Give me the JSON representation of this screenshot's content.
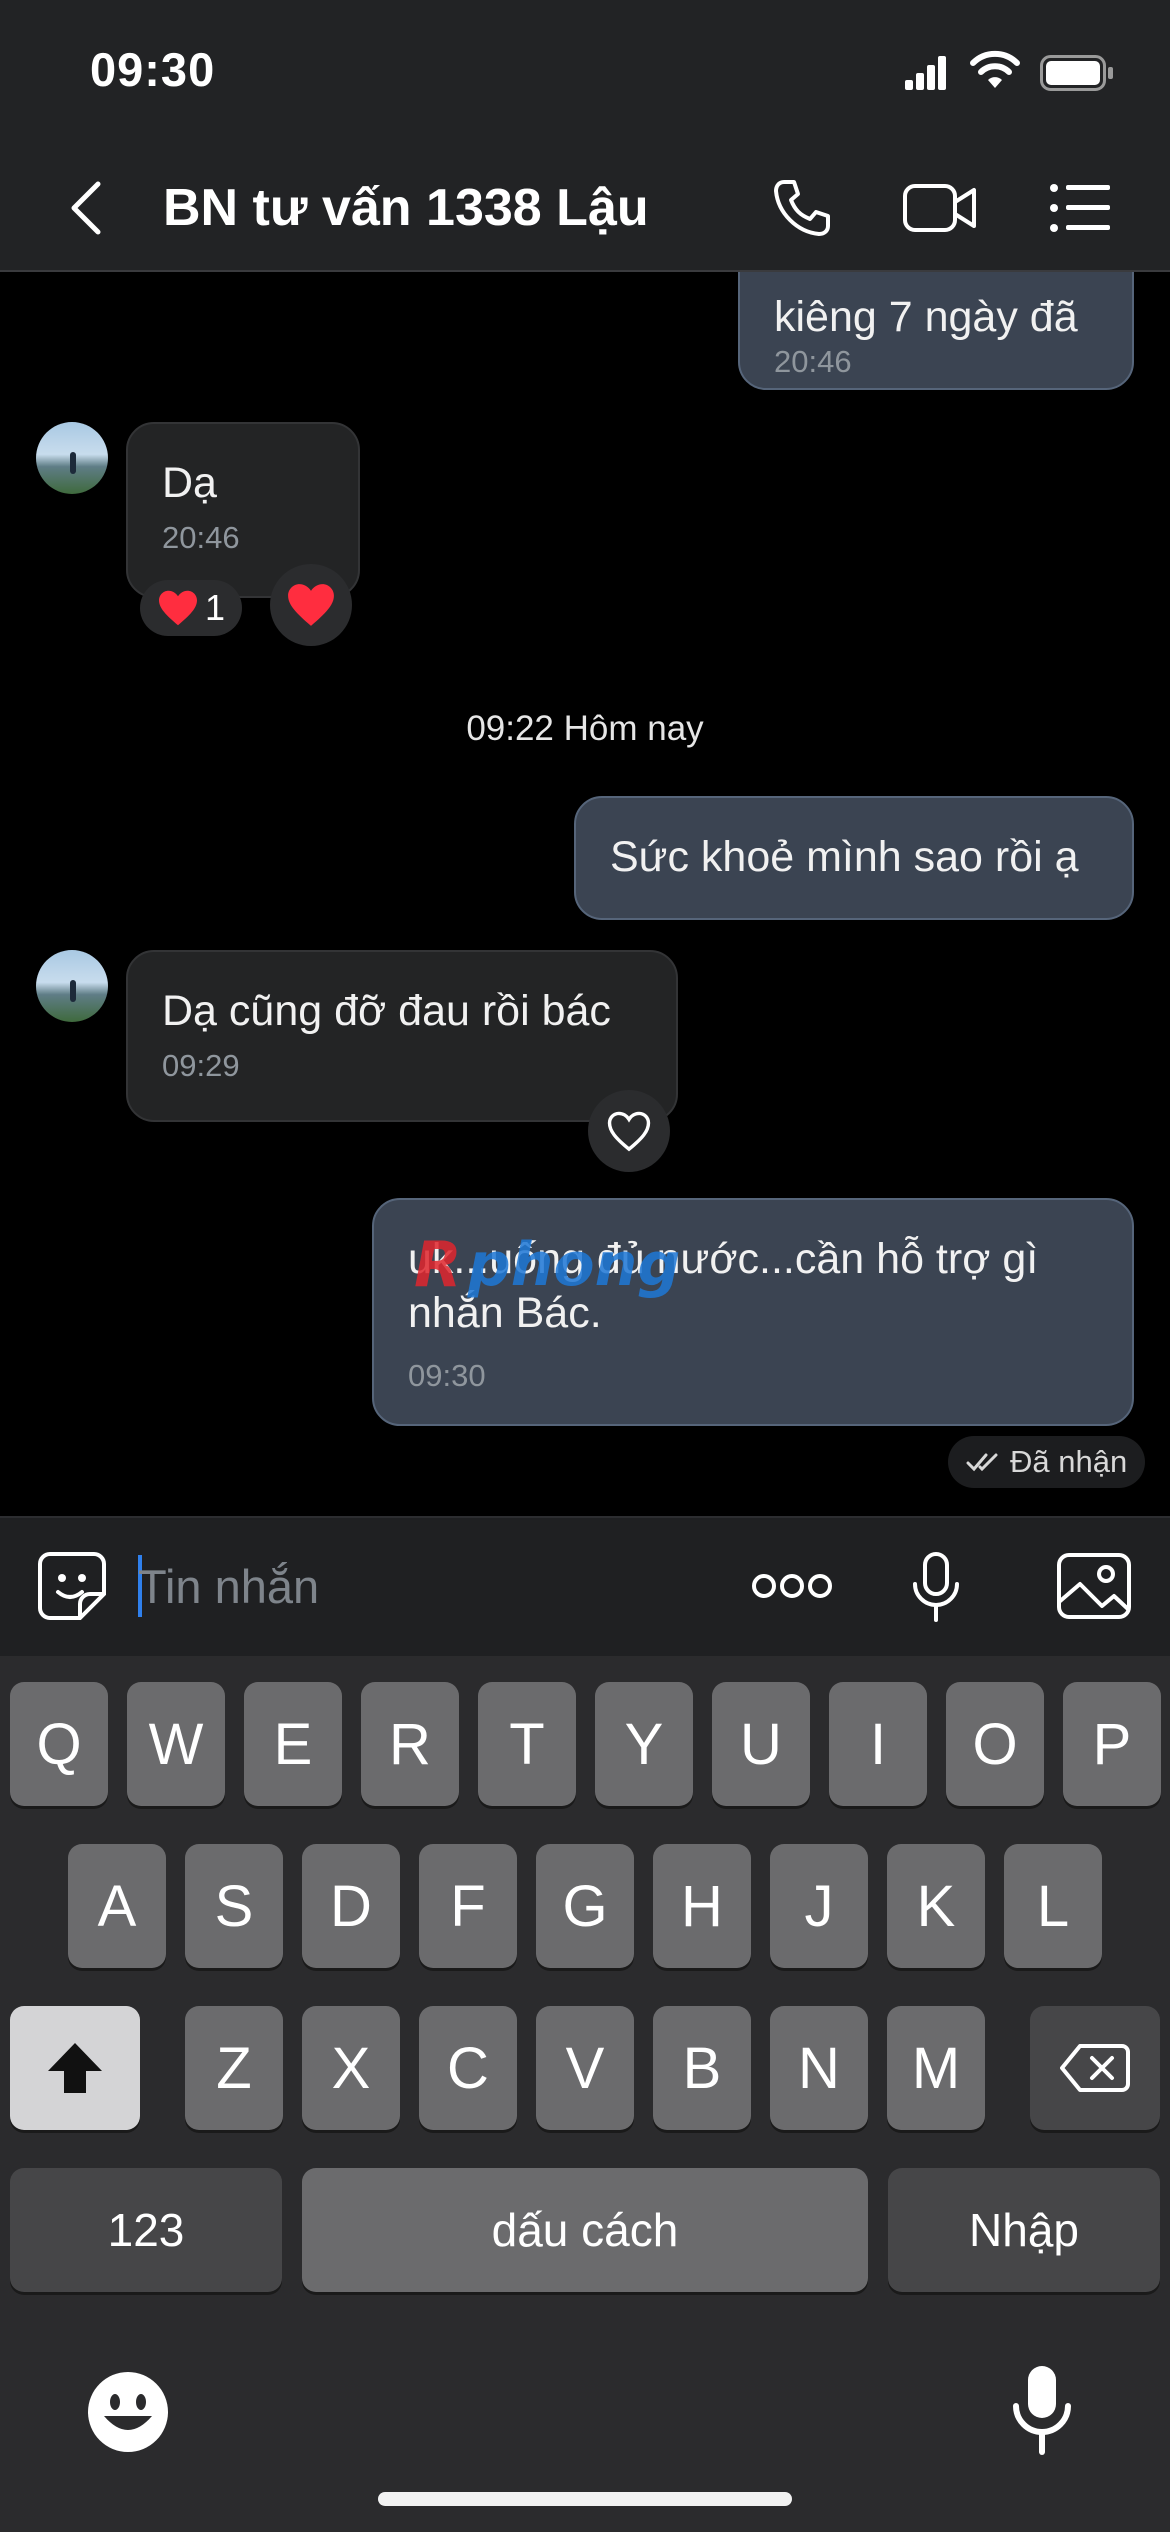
{
  "status_bar": {
    "time": "09:30"
  },
  "header": {
    "title": "BN tư vấn 1338 Lậu"
  },
  "messages": {
    "top_partial": {
      "text": "kiêng 7 ngày đã",
      "time": "20:46"
    },
    "msg1": {
      "text": "Dạ",
      "time": "20:46",
      "reaction_count": "1"
    },
    "separator": "09:22 Hôm nay",
    "msg2": {
      "text": "Sức khoẻ mình sao rồi ạ"
    },
    "msg3": {
      "text": "Dạ cũng đỡ đau rồi bác",
      "time": "09:29"
    },
    "msg4": {
      "line1": "uk...uống đủ nước...cần hỗ trợ gì",
      "line2": "nhắn Bác.",
      "time": "09:30",
      "status": "Đã nhận"
    }
  },
  "watermark": {
    "text": "phong"
  },
  "composer": {
    "placeholder": "Tin nhắn"
  },
  "keyboard": {
    "row1": [
      "Q",
      "W",
      "E",
      "R",
      "T",
      "Y",
      "U",
      "I",
      "O",
      "P"
    ],
    "row2": [
      "A",
      "S",
      "D",
      "F",
      "G",
      "H",
      "J",
      "K",
      "L"
    ],
    "row3": [
      "Z",
      "X",
      "C",
      "V",
      "B",
      "N",
      "M"
    ],
    "numbers": "123",
    "space": "dấu cách",
    "enter": "Nhập"
  },
  "colors": {
    "header_bg": "#222325",
    "outgoing_bubble": "#3b4452",
    "incoming_bubble": "#232425",
    "heart": "#ff2d3f",
    "caret": "#2f80ed"
  },
  "icons": [
    "back-chevron-icon",
    "phone-icon",
    "video-call-icon",
    "menu-list-icon",
    "sticker-icon",
    "more-options-icon",
    "microphone-icon",
    "image-icon",
    "shift-icon",
    "backspace-icon",
    "emoji-icon",
    "dictation-mic-icon",
    "double-check-icon",
    "heart-icon",
    "heart-outline-icon"
  ]
}
